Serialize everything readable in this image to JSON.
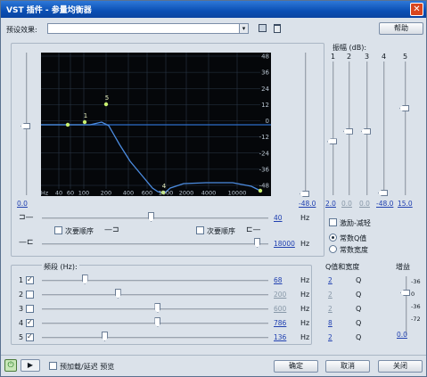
{
  "window": {
    "title": "VST 插件 - 参量均衡器"
  },
  "toolbar": {
    "preset_label": "预设效果:",
    "preset_value": "",
    "help": "帮助"
  },
  "amplitude": {
    "label": "振幅 (dB):",
    "bands": [
      "1",
      "2",
      "3",
      "4",
      "5"
    ],
    "values": [
      "2.0",
      "0.0",
      "0.0",
      "-48.0",
      "15.0"
    ],
    "positions": [
      0.4,
      0.48,
      0.48,
      0.0,
      0.66
    ]
  },
  "master_gain": {
    "left_value": "0.0",
    "right_value": "-48.0",
    "left_pos": 0.5,
    "right_pos": 0.0
  },
  "graph": {
    "y_ticks": [
      "48",
      "36",
      "24",
      "12",
      "0",
      "-12",
      "-24",
      "-36",
      "-48"
    ],
    "x_ticks": [
      "Hz",
      "40",
      "60",
      "100",
      "200",
      "400",
      "600",
      "1000",
      "2000",
      "4000",
      "10000"
    ],
    "bands_marked": [
      "1",
      "5",
      "4"
    ]
  },
  "lowshelf": {
    "value": "40",
    "unit": "Hz",
    "position": 0.48,
    "checkbox": "次要顺序",
    "checked": false
  },
  "highshelf": {
    "value": "18000",
    "unit": "Hz",
    "position": 0.96,
    "checkbox": "次要顺序",
    "checked": false
  },
  "options": {
    "boost_cut": "激励-减轻",
    "boost_cut_checked": false,
    "constant_q": "常数Q值",
    "constant_width": "常数宽度",
    "constant_q_selected": true
  },
  "bands": {
    "freq_label": "频段 (Hz):",
    "q_label": "Q值和宽度",
    "gain_label": "增益",
    "rows": [
      {
        "id": "1",
        "checked": true,
        "freq": "68",
        "freq_unit": "Hz",
        "q": "2",
        "q_unit": "Q",
        "pos": 0.18
      },
      {
        "id": "2",
        "checked": false,
        "freq": "200",
        "freq_unit": "Hz",
        "q": "2",
        "q_unit": "Q",
        "pos": 0.33
      },
      {
        "id": "3",
        "checked": false,
        "freq": "600",
        "freq_unit": "Hz",
        "q": "2",
        "q_unit": "Q",
        "pos": 0.51
      },
      {
        "id": "4",
        "checked": true,
        "freq": "786",
        "freq_unit": "Hz",
        "q": "8",
        "q_unit": "Q",
        "pos": 0.51
      },
      {
        "id": "5",
        "checked": true,
        "freq": "136",
        "freq_unit": "Hz",
        "q": "2",
        "q_unit": "Q",
        "pos": 0.27
      }
    ],
    "gain_ticks": [
      "-36",
      "0",
      "-36",
      "-72"
    ],
    "gain_value": "0.0"
  },
  "footer": {
    "preview_label": "预加载/延迟 预览",
    "ok": "确定",
    "cancel": "取消",
    "close": "关闭"
  }
}
